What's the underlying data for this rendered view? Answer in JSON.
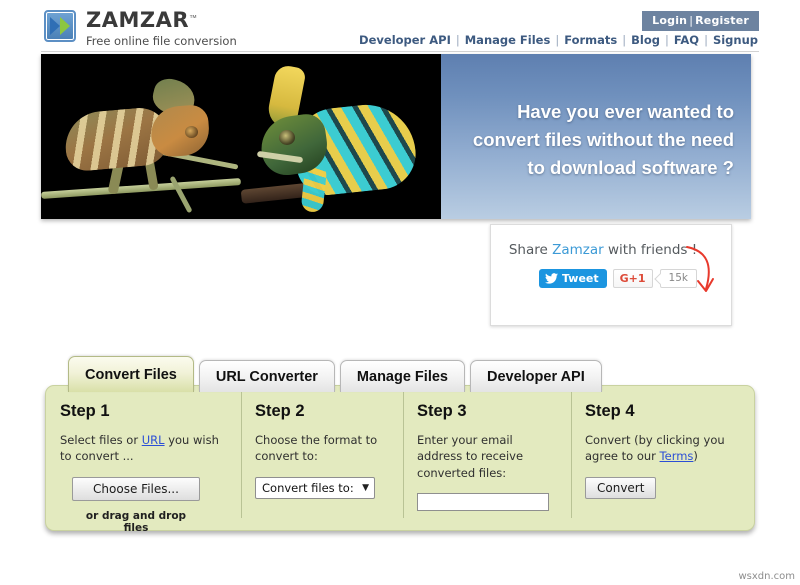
{
  "header": {
    "logo_word": "ZAMZAR",
    "logo_tm": "™",
    "tagline": "Free online file conversion",
    "login": "Login",
    "login_separator": "|",
    "register": "Register",
    "nav": [
      {
        "label": "Developer API"
      },
      {
        "label": "Manage Files"
      },
      {
        "label": "Formats"
      },
      {
        "label": "Blog"
      },
      {
        "label": "FAQ"
      },
      {
        "label": "Signup"
      }
    ],
    "nav_separator": "|"
  },
  "banner": {
    "headline_line1": "Have you ever wanted to",
    "headline_line2": "convert files without the need",
    "headline_line3": "to download software ?",
    "photo_left_alt": "brown chameleon on branch",
    "photo_right_alt": "cyan and yellow striped chameleon"
  },
  "share": {
    "title_prefix": "Share ",
    "brand": "Zamzar",
    "title_suffix": " with friends !",
    "tweet_label": "Tweet",
    "gplus_label": "G+1",
    "count_label": "15k"
  },
  "tabs": [
    {
      "label": "Convert Files",
      "active": true
    },
    {
      "label": "URL Converter",
      "active": false
    },
    {
      "label": "Manage Files",
      "active": false
    },
    {
      "label": "Developer API",
      "active": false
    }
  ],
  "steps": {
    "step1": {
      "title": "Step 1",
      "desc_before": "Select files or ",
      "desc_link": "URL",
      "desc_after": " you wish to convert ...",
      "button": "Choose Files...",
      "note": "or drag and drop files"
    },
    "step2": {
      "title": "Step 2",
      "desc": "Choose the format to convert to:",
      "select_value": "Convert files to:",
      "select_caret": "▼"
    },
    "step3": {
      "title": "Step 3",
      "desc": "Enter your email address to receive converted files:",
      "input_value": "",
      "input_placeholder": ""
    },
    "step4": {
      "title": "Step 4",
      "desc_before": "Convert (by clicking you agree to our ",
      "desc_link": "Terms",
      "desc_after": ")",
      "button": "Convert"
    }
  },
  "watermark": "wsxdn.com",
  "colors": {
    "brand_blue": "#3c9ad6",
    "nav_blue": "#3d5a80",
    "login_badge": "#6d83a0",
    "panel_green": "#e3eabf",
    "tab_active": "#d9e0a8",
    "link": "#2b4fd6",
    "tweet_blue": "#1b95e0",
    "gplus_red": "#dd4b39",
    "arrow_red": "#e8392c"
  }
}
